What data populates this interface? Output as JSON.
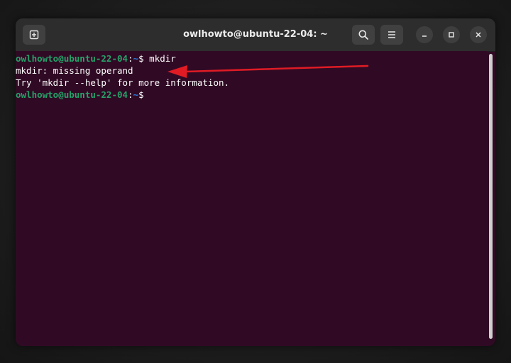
{
  "window": {
    "title": "owlhowto@ubuntu-22-04: ~",
    "buttons": {
      "new_tab": "new-tab-icon",
      "search": "search-icon",
      "menu": "hamburger-menu-icon",
      "minimize": "minimize-icon",
      "maximize": "maximize-icon",
      "close": "close-icon"
    }
  },
  "terminal": {
    "lines": [
      {
        "user": "owlhowto@ubuntu-22-04",
        "sep": ":",
        "path": "~",
        "prompt": "$ ",
        "command": "mkdir"
      },
      {
        "text": "mkdir: missing operand"
      },
      {
        "text": "Try 'mkdir --help' for more information."
      },
      {
        "user": "owlhowto@ubuntu-22-04",
        "sep": ":",
        "path": "~",
        "prompt": "$ ",
        "command": ""
      }
    ]
  },
  "annotation": {
    "arrow_color": "#e01b24",
    "points_to": "mkdir: missing operand"
  },
  "colors": {
    "terminal_bg": "#300a24",
    "titlebar_bg": "#2d2d2d",
    "prompt_user": "#26a269",
    "prompt_path": "#2a7bde"
  }
}
